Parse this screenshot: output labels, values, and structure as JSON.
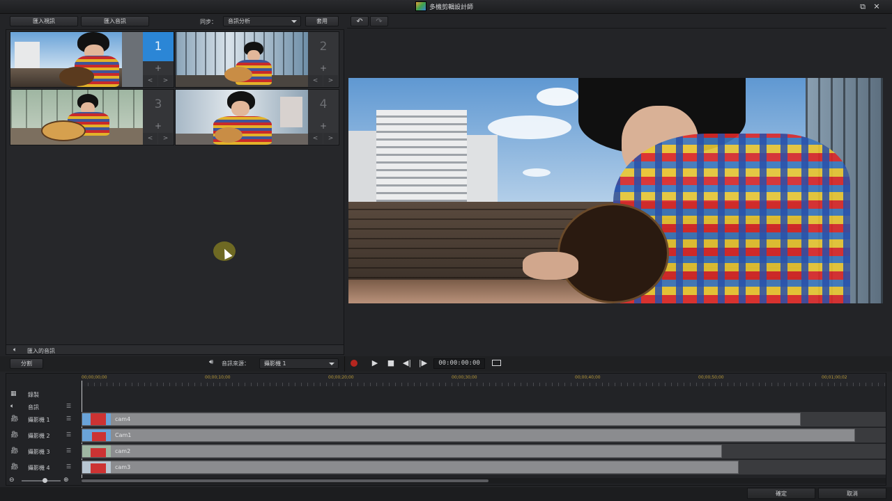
{
  "window": {
    "title": "多機剪輯設計師",
    "restore_icon": "⧉",
    "close_icon": "✕"
  },
  "left_toolbar": {
    "import_video": "匯入視訊",
    "import_audio": "匯入音訊",
    "sync_label": "同步：",
    "sync_value": "音訊分析",
    "apply": "套用"
  },
  "right_toolbar": {
    "undo_icon": "↶",
    "redo_icon": "↷"
  },
  "cameras": [
    {
      "number": "1",
      "active": true
    },
    {
      "number": "2",
      "active": false
    },
    {
      "number": "3",
      "active": false
    },
    {
      "number": "4",
      "active": false
    }
  ],
  "camera_controls": {
    "add": "+",
    "prev": "<",
    "next": ">"
  },
  "left_footer": {
    "label": "匯入的音訊"
  },
  "controls": {
    "split": "分割",
    "audio_source_label": "音訊來源：",
    "audio_source_value": "攝影機 1",
    "timecode": "00:00:00:00"
  },
  "ruler_ticks": [
    "00;00;00;00",
    "00;00;10;00",
    "00;00;20;00",
    "00;00;30;00",
    "00;00;40;00",
    "00;00;50;00",
    "00;01;00;02"
  ],
  "tracks": [
    {
      "name": "錄製",
      "icon": "film",
      "clip": null
    },
    {
      "name": "音訊",
      "icon": "audio",
      "clip": null
    },
    {
      "name": "攝影機 1",
      "icon": "camera",
      "clip": {
        "name": "cam4",
        "end": 0.894
      }
    },
    {
      "name": "攝影機 2",
      "icon": "camera",
      "clip": {
        "name": "Cam1",
        "end": 0.962
      }
    },
    {
      "name": "攝影機 3",
      "icon": "camera",
      "clip": {
        "name": "cam2",
        "end": 0.796
      }
    },
    {
      "name": "攝影機 4",
      "icon": "camera",
      "clip": {
        "name": "cam3",
        "end": 0.817
      }
    }
  ],
  "bottom": {
    "ok": "確定",
    "cancel": "取消"
  }
}
